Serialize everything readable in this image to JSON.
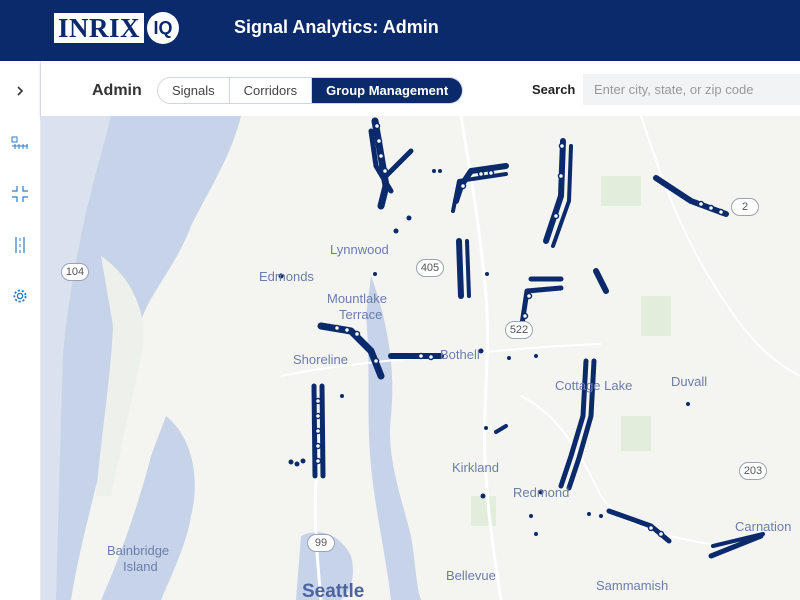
{
  "header": {
    "logo_text": "INRIX",
    "logo_badge": "IQ",
    "title": "Signal Analytics: Admin"
  },
  "toolbar": {
    "section_title": "Admin",
    "tabs": [
      {
        "label": "Signals",
        "active": false
      },
      {
        "label": "Corridors",
        "active": false
      },
      {
        "label": "Group Management",
        "active": true
      }
    ],
    "search_label": "Search",
    "search_placeholder": "Enter city, state, or zip code"
  },
  "sidebar": {
    "items": [
      {
        "icon": "chevron-right-icon"
      },
      {
        "icon": "signals-icon"
      },
      {
        "icon": "intersection-icon"
      },
      {
        "icon": "corridor-icon"
      },
      {
        "icon": "gear-icon"
      }
    ]
  },
  "map": {
    "places": [
      "Lynnwood",
      "Edmonds",
      "Mountlake",
      "Terrace",
      "Shoreline",
      "Bothell",
      "Cottage Lake",
      "Duvall",
      "Kirkland",
      "Redmond",
      "Carnation",
      "Bainbridge",
      "Island",
      "Seattle",
      "Bellevue",
      "Sammamish"
    ],
    "shields": [
      "104",
      "405",
      "522",
      "2",
      "203",
      "99"
    ]
  }
}
